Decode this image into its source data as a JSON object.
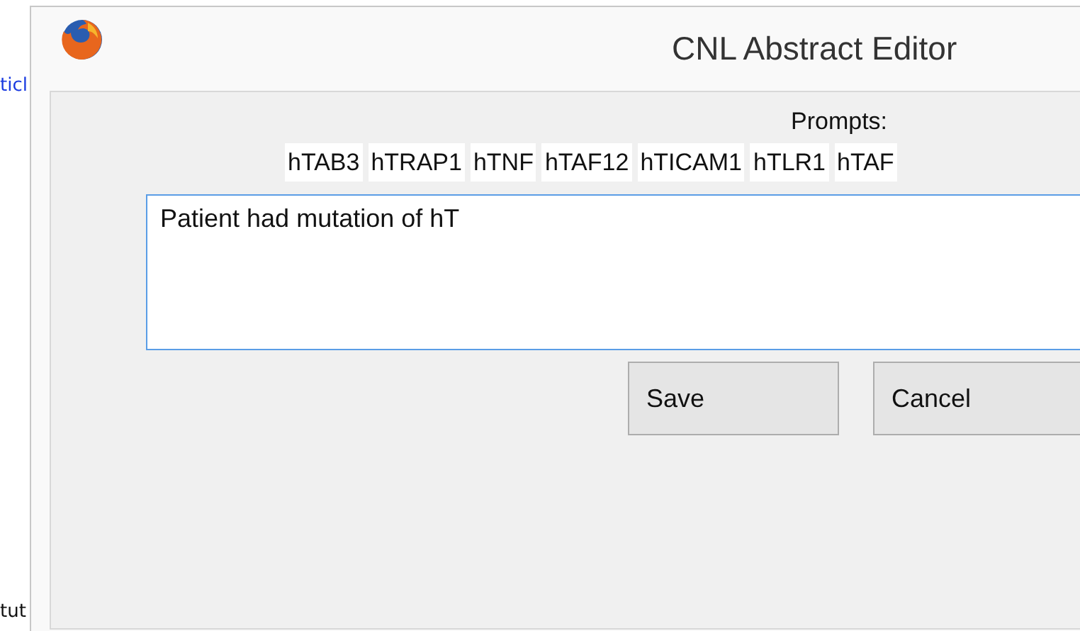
{
  "background_page": {
    "link_text": "ticl",
    "text": "tut"
  },
  "window": {
    "title": "CNL Abstract Editor"
  },
  "prompts": {
    "label": "Prompts:",
    "items": [
      "hTAB3",
      "hTRAP1",
      "hTNF",
      "hTAF12",
      "hTICAM1",
      "hTLR1",
      "hTAF"
    ]
  },
  "editor": {
    "value": "Patient had mutation of hT"
  },
  "buttons": [
    "Save",
    "Cancel"
  ]
}
